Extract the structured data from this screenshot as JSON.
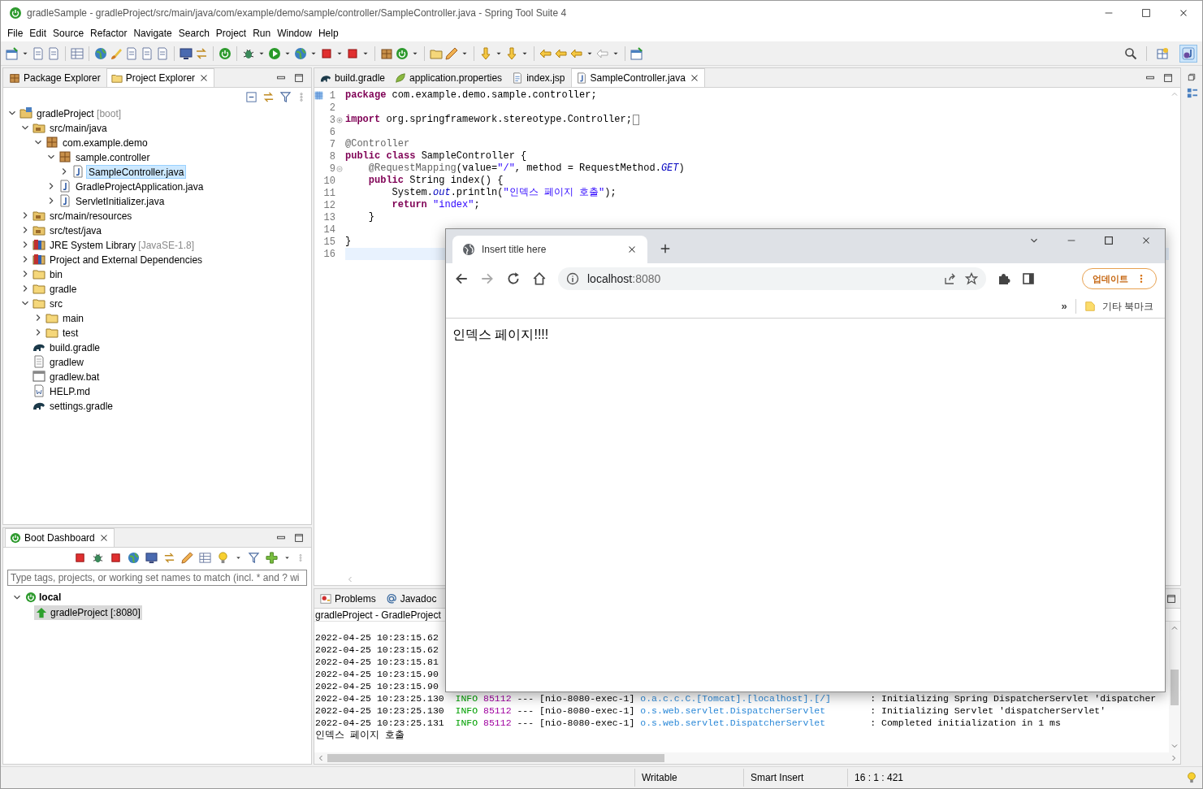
{
  "window": {
    "title": "gradleSample - gradleProject/src/main/java/com/example/demo/sample/controller/SampleController.java - Spring Tool Suite 4"
  },
  "menu": [
    "File",
    "Edit",
    "Source",
    "Refactor",
    "Navigate",
    "Search",
    "Project",
    "Run",
    "Window",
    "Help"
  ],
  "explorer": {
    "tabs": [
      {
        "label": "Package Explorer",
        "selected": false
      },
      {
        "label": "Project Explorer",
        "selected": true
      }
    ],
    "tree": [
      {
        "label": "gradleProject",
        "decoration": "[boot]",
        "kind": "project",
        "expanded": true,
        "selected": false,
        "children": [
          {
            "label": "src/main/java",
            "kind": "srcfolder",
            "expanded": true,
            "selected": false,
            "children": [
              {
                "label": "com.example.demo",
                "kind": "package",
                "expanded": true,
                "selected": false,
                "children": [
                  {
                    "label": "sample.controller",
                    "kind": "package",
                    "expanded": true,
                    "selected": false,
                    "children": [
                      {
                        "label": "SampleController.java",
                        "kind": "java",
                        "expanded": false,
                        "selected": true
                      }
                    ]
                  },
                  {
                    "label": "GradleProjectApplication.java",
                    "kind": "java",
                    "expanded": false,
                    "selected": false
                  },
                  {
                    "label": "ServletInitializer.java",
                    "kind": "java",
                    "expanded": false,
                    "selected": false
                  }
                ]
              }
            ]
          },
          {
            "label": "src/main/resources",
            "kind": "srcfolder",
            "expanded": false,
            "selected": false
          },
          {
            "label": "src/test/java",
            "kind": "srcfolder",
            "expanded": false,
            "selected": false
          },
          {
            "label": "JRE System Library",
            "decoration": "[JavaSE-1.8]",
            "kind": "library",
            "expanded": false,
            "selected": false
          },
          {
            "label": "Project and External Dependencies",
            "kind": "library",
            "expanded": false,
            "selected": false
          },
          {
            "label": "bin",
            "kind": "folder",
            "expanded": false,
            "selected": false
          },
          {
            "label": "gradle",
            "kind": "folder",
            "expanded": false,
            "selected": false
          },
          {
            "label": "src",
            "kind": "folder",
            "expanded": true,
            "selected": false,
            "children": [
              {
                "label": "main",
                "kind": "folder",
                "expanded": false,
                "selected": false
              },
              {
                "label": "test",
                "kind": "folder",
                "expanded": false,
                "selected": false
              }
            ]
          },
          {
            "label": "build.gradle",
            "kind": "gradle",
            "selected": false
          },
          {
            "label": "gradlew",
            "kind": "file",
            "selected": false
          },
          {
            "label": "gradlew.bat",
            "kind": "batfile",
            "selected": false
          },
          {
            "label": "HELP.md",
            "kind": "mdfile",
            "selected": false
          },
          {
            "label": "settings.gradle",
            "kind": "gradle",
            "selected": false
          }
        ]
      }
    ]
  },
  "boot_dashboard": {
    "tab": "Boot Dashboard",
    "filter": {
      "placeholder": "Type tags, projects, or working set names to match (incl. * and ? wi"
    },
    "tree": [
      {
        "label": "local",
        "expanded": true,
        "children": [
          {
            "label": "gradleProject [:8080]",
            "selected": true
          }
        ]
      }
    ]
  },
  "editor": {
    "tabs": [
      {
        "label": "build.gradle",
        "kind": "gradle",
        "selected": false
      },
      {
        "label": "application.properties",
        "kind": "leaf",
        "selected": false
      },
      {
        "label": "index.jsp",
        "kind": "jsp",
        "selected": false
      },
      {
        "label": "SampleController.java",
        "kind": "java",
        "selected": true
      }
    ],
    "lines": [
      {
        "num": "1",
        "tokens": [
          {
            "kind": "keyword",
            "text": "package"
          },
          {
            "kind": "plain",
            "text": " com.example.demo.sample.controller;"
          }
        ]
      },
      {
        "num": "2"
      },
      {
        "num": "3",
        "collapsed": true,
        "tokens": [
          {
            "kind": "keyword",
            "text": "import"
          },
          {
            "kind": "plain",
            "text": " org.springframework.stereotype.Controller;"
          }
        ]
      },
      {
        "num": "6"
      },
      {
        "num": "7",
        "tokens": [
          {
            "kind": "annotation",
            "text": "@Controller"
          }
        ]
      },
      {
        "num": "8",
        "tokens": [
          {
            "kind": "keyword",
            "text": "public"
          },
          {
            "kind": "keyword",
            "text": " class"
          },
          {
            "kind": "plain",
            "text": " SampleController {"
          }
        ]
      },
      {
        "num": "9",
        "collapsed": false,
        "tokens": [
          {
            "kind": "annotation",
            "text": "    @RequestMapping"
          },
          {
            "kind": "plain",
            "text": "(value="
          },
          {
            "kind": "string",
            "text": "\"/\""
          },
          {
            "kind": "plain",
            "text": ", method = RequestMethod."
          },
          {
            "kind": "static",
            "text": "GET"
          },
          {
            "kind": "plain",
            "text": ")"
          }
        ]
      },
      {
        "num": "10",
        "tokens": [
          {
            "kind": "keyword",
            "text": "    public"
          },
          {
            "kind": "plain",
            "text": " String index() {"
          }
        ]
      },
      {
        "num": "11",
        "tokens": [
          {
            "kind": "plain",
            "text": "        System."
          },
          {
            "kind": "static",
            "text": "out"
          },
          {
            "kind": "plain",
            "text": ".println("
          },
          {
            "kind": "string",
            "text": "\"인덱스 페이지 호출\""
          },
          {
            "kind": "plain",
            "text": ");"
          }
        ]
      },
      {
        "num": "12",
        "tokens": [
          {
            "kind": "keyword",
            "text": "        return"
          },
          {
            "kind": "string",
            "text": " \"index\""
          },
          {
            "kind": "plain",
            "text": ";"
          }
        ]
      },
      {
        "num": "13",
        "tokens": [
          {
            "kind": "plain",
            "text": "    }"
          }
        ]
      },
      {
        "num": "14"
      },
      {
        "num": "15",
        "tokens": [
          {
            "kind": "plain",
            "text": "}"
          }
        ]
      },
      {
        "num": "16",
        "current": true
      }
    ]
  },
  "console": {
    "tabs": [
      {
        "label": "Problems",
        "kind": "problems"
      },
      {
        "label": "Javadoc",
        "kind": "at"
      }
    ],
    "header": "gradleProject - GradleProject",
    "lines": [
      {
        "tokens": [
          {
            "kind": "plain",
            "text": "2022-04-25 10:23:15.62"
          }
        ]
      },
      {
        "tokens": [
          {
            "kind": "plain",
            "text": "2022-04-25 10:23:15.62"
          }
        ]
      },
      {
        "tokens": [
          {
            "kind": "plain",
            "text": "2022-04-25 10:23:15.81"
          }
        ]
      },
      {
        "tokens": [
          {
            "kind": "plain",
            "text": "2022-04-25 10:23:15.90"
          }
        ]
      },
      {
        "tokens": [
          {
            "kind": "plain",
            "text": "2022-04-25 10:23:15.90"
          }
        ]
      },
      {
        "tokens": [
          {
            "kind": "plain",
            "text": "2022-04-25 10:23:25.130  "
          },
          {
            "kind": "level",
            "text": "INFO"
          },
          {
            "kind": "pid",
            "text": " 85112"
          },
          {
            "kind": "plain",
            "text": " --- [nio-8080-exec-1] "
          },
          {
            "kind": "logger",
            "text": "o.a.c.c.C.[Tomcat].[localhost].[/]"
          },
          {
            "kind": "plain",
            "text": "       : Initializing Spring DispatcherServlet 'dispatcher"
          }
        ]
      },
      {
        "tokens": [
          {
            "kind": "plain",
            "text": "2022-04-25 10:23:25.130  "
          },
          {
            "kind": "level",
            "text": "INFO"
          },
          {
            "kind": "pid",
            "text": " 85112"
          },
          {
            "kind": "plain",
            "text": " --- [nio-8080-exec-1] "
          },
          {
            "kind": "logger",
            "text": "o.s.web.servlet.DispatcherServlet"
          },
          {
            "kind": "plain",
            "text": "        : Initializing Servlet 'dispatcherServlet'"
          }
        ]
      },
      {
        "tokens": [
          {
            "kind": "plain",
            "text": "2022-04-25 10:23:25.131  "
          },
          {
            "kind": "level",
            "text": "INFO"
          },
          {
            "kind": "pid",
            "text": " 85112"
          },
          {
            "kind": "plain",
            "text": " --- [nio-8080-exec-1] "
          },
          {
            "kind": "logger",
            "text": "o.s.web.servlet.DispatcherServlet"
          },
          {
            "kind": "plain",
            "text": "        : Completed initialization in 1 ms"
          }
        ]
      },
      {
        "tokens": [
          {
            "kind": "plain",
            "text": "인덱스 페이지 호출"
          }
        ]
      }
    ]
  },
  "status_bar": [
    "Writable",
    "Smart Insert",
    "16 : 1 : 421"
  ],
  "browser": {
    "tab_title": "Insert title here",
    "address_host": "localhost",
    "address_port": ":8080",
    "update_button": "업데이트",
    "bookmarks_overflow": "»",
    "bookmarks_folder": "기타 북마크",
    "page_text": "인덱스 페이지!!!!"
  }
}
